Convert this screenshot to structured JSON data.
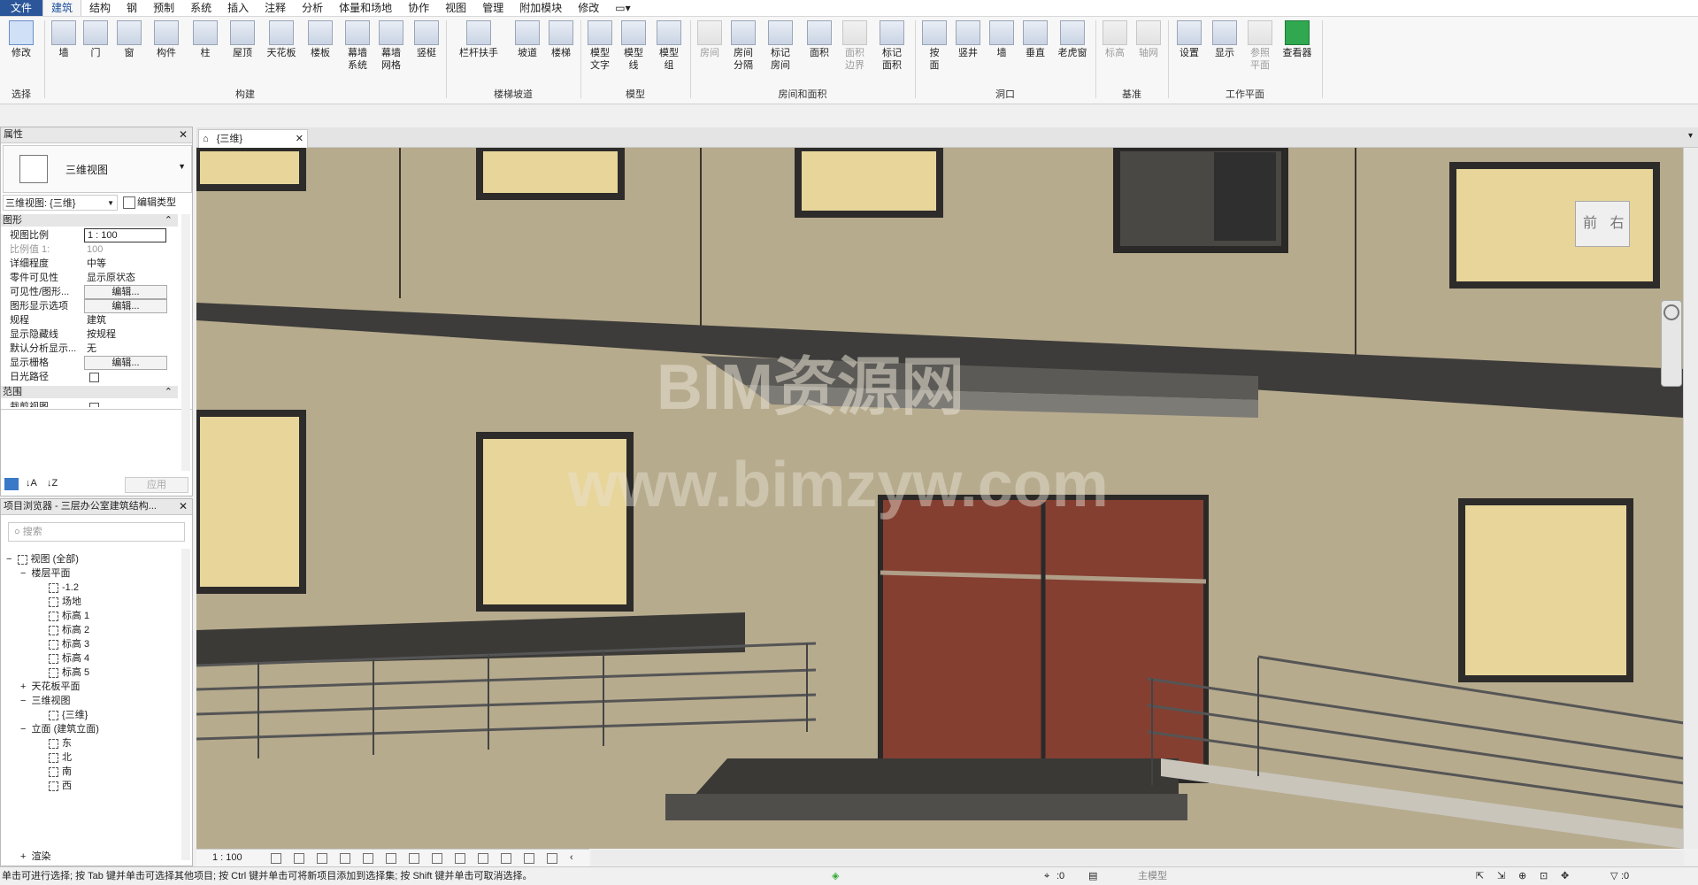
{
  "menu": [
    "文件",
    "建筑",
    "结构",
    "钢",
    "预制",
    "系统",
    "插入",
    "注释",
    "分析",
    "体量和场地",
    "协作",
    "视图",
    "管理",
    "附加模块",
    "修改"
  ],
  "tools": {
    "modify": "修改",
    "wall": "墙",
    "door": "门",
    "window": "窗",
    "component": "构件",
    "column": "柱",
    "roof": "屋顶",
    "ceiling": "天花板",
    "floor": "楼板",
    "curtain_system": "幕墙\n系统",
    "curtain_grid": "幕墙\n网格",
    "mullion": "竖梃",
    "railing": "栏杆扶手",
    "ramp": "坡道",
    "stair": "楼梯",
    "model_text": "模型\n文字",
    "model_line": "模型\n线",
    "model_group": "模型\n组",
    "room": "房间",
    "room_separator": "房间\n分隔",
    "tag_room": "标记\n房间",
    "area": "面积",
    "area_boundary": "面积\n边界",
    "tag_area": "标记\n面积",
    "by_face": "按\n面",
    "shaft": "竖井",
    "wall_opening": "墙",
    "vertical": "垂直",
    "dormer": "老虎窗",
    "level": "标高",
    "grid": "轴网",
    "set": "设置",
    "show": "显示",
    "ref_plane": "参照\n平面",
    "viewer": "查看器"
  },
  "groups": {
    "select": "选择",
    "build": "构建",
    "circulation": "楼梯坡道",
    "model": "模型",
    "room_area": "房间和面积",
    "opening": "洞口",
    "datum": "基准",
    "workplane": "工作平面"
  },
  "properties": {
    "title": "属性",
    "type_name": "三维视图",
    "selector": "三维视图: {三维}",
    "edit_type": "编辑类型",
    "section_graphics": "图形",
    "section_extents": "范围",
    "apply": "应用",
    "rows": [
      {
        "k": "视图比例",
        "v": "1 : 100"
      },
      {
        "k": "比例值 1:",
        "v": "100"
      },
      {
        "k": "详细程度",
        "v": "中等"
      },
      {
        "k": "零件可见性",
        "v": "显示原状态"
      },
      {
        "k": "可见性/图形...",
        "v": "编辑..."
      },
      {
        "k": "图形显示选项",
        "v": "编辑..."
      },
      {
        "k": "规程",
        "v": "建筑"
      },
      {
        "k": "显示隐藏线",
        "v": "按规程"
      },
      {
        "k": "默认分析显示...",
        "v": "无"
      },
      {
        "k": "显示栅格",
        "v": "编辑..."
      },
      {
        "k": "日光路径",
        "v": ""
      },
      {
        "k": "裁剪视图",
        "v": ""
      }
    ]
  },
  "browser": {
    "title": "项目浏览器 - 三层办公室建筑结构...",
    "search_placeholder": "搜索",
    "items": [
      "视图 (全部)",
      "楼层平面",
      "-1.2",
      "场地",
      "标高 1",
      "标高 2",
      "标高 3",
      "标高 4",
      "标高 5",
      "天花板平面",
      "三维视图",
      "{三维}",
      "立面 (建筑立面)",
      "东",
      "北",
      "南",
      "西",
      "渲染"
    ]
  },
  "view": {
    "tab": "{三维}",
    "viewcube_front": "前",
    "viewcube_right": "右",
    "watermark1": "BIM资源网",
    "watermark2": "www.bimzyw.com",
    "scale": "1 : 100"
  },
  "status": {
    "hint": "单击可进行选择; 按 Tab 键并单击可选择其他项目; 按 Ctrl 键并单击可将新项目添加到选择集; 按 Shift 键并单击可取消选择。",
    "zero": ":0",
    "model": "主模型",
    "filter": ":0"
  }
}
